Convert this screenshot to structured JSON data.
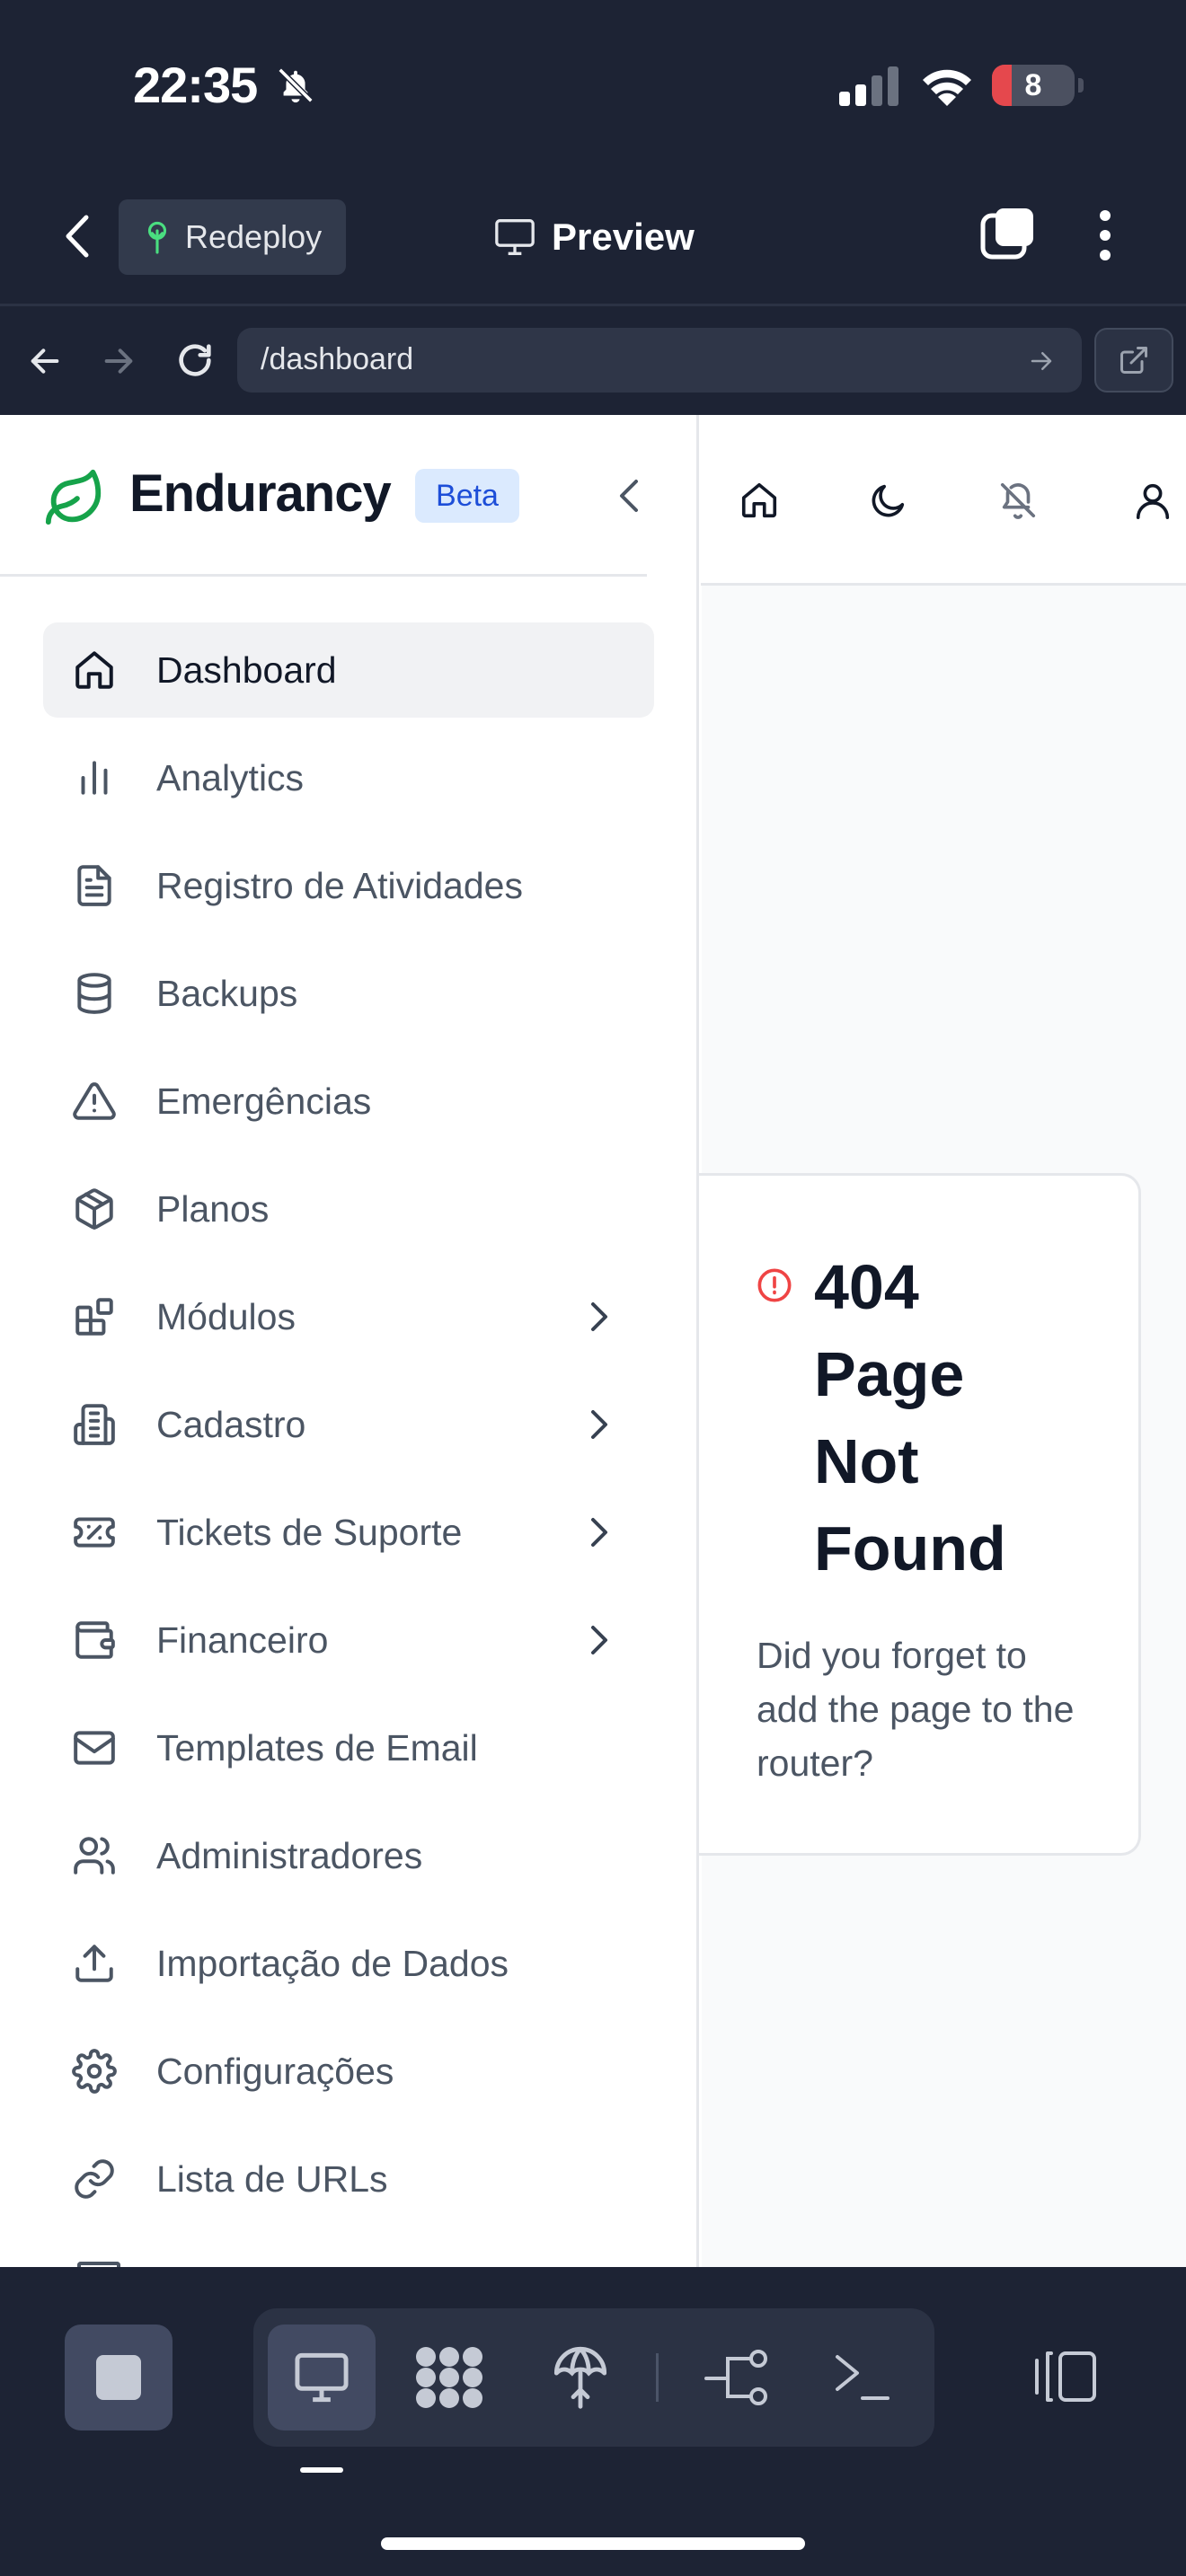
{
  "status_bar": {
    "time": "22:35",
    "battery": "8"
  },
  "app_bar": {
    "redeploy_label": "Redeploy",
    "preview_label": "Preview"
  },
  "browser": {
    "url": "/dashboard"
  },
  "sidebar": {
    "brand": "Endurancy",
    "badge": "Beta",
    "items": [
      {
        "label": "Dashboard",
        "icon": "home-icon"
      },
      {
        "label": "Analytics",
        "icon": "bar-chart-icon"
      },
      {
        "label": "Registro de Atividades",
        "icon": "file-text-icon"
      },
      {
        "label": "Backups",
        "icon": "database-icon"
      },
      {
        "label": "Emergências",
        "icon": "alert-triangle-icon"
      },
      {
        "label": "Planos",
        "icon": "package-icon"
      },
      {
        "label": "Módulos",
        "icon": "blocks-icon"
      },
      {
        "label": "Cadastro",
        "icon": "building-icon"
      },
      {
        "label": "Tickets de Suporte",
        "icon": "ticket-icon"
      },
      {
        "label": "Financeiro",
        "icon": "wallet-icon"
      },
      {
        "label": "Templates de Email",
        "icon": "mail-icon"
      },
      {
        "label": "Administradores",
        "icon": "users-icon"
      },
      {
        "label": "Importação de Dados",
        "icon": "upload-icon"
      },
      {
        "label": "Configurações",
        "icon": "gear-icon"
      },
      {
        "label": "Lista de URLs",
        "icon": "link-icon"
      }
    ]
  },
  "not_found": {
    "title": "404 Page Not Found",
    "message": "Did you forget to add the page to the router?"
  },
  "colors": {
    "chrome_bg": "#1d2334",
    "brand_green": "#16a34a",
    "error_red": "#ef4444",
    "beta_bg": "#dbeafe",
    "beta_text": "#1d4ed8"
  }
}
